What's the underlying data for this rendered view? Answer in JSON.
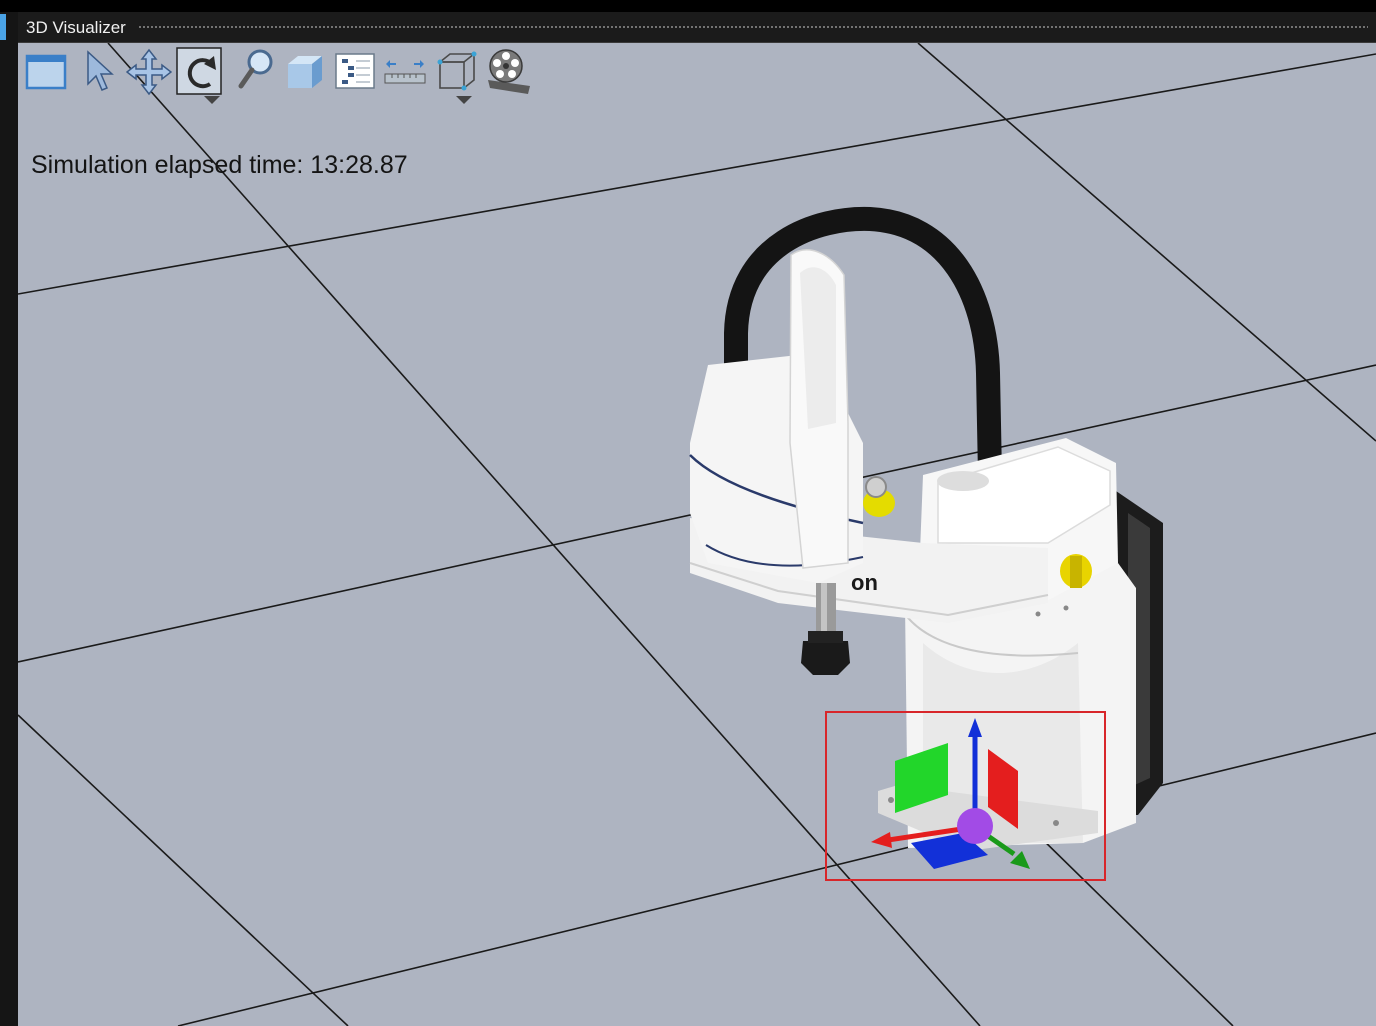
{
  "window": {
    "title": "3D Visualizer"
  },
  "toolbar": {
    "tools": [
      {
        "name": "view-window",
        "icon": "window-icon"
      },
      {
        "name": "select",
        "icon": "arrow-cursor-icon"
      },
      {
        "name": "pan",
        "icon": "move-arrows-icon"
      },
      {
        "name": "rotate",
        "icon": "rotate-icon",
        "active": true,
        "has_dropdown": true
      },
      {
        "name": "zoom",
        "icon": "magnifier-icon"
      },
      {
        "name": "3d-box",
        "icon": "cube-icon"
      },
      {
        "name": "tree",
        "icon": "tree-list-icon"
      },
      {
        "name": "measure",
        "icon": "ruler-icon"
      },
      {
        "name": "bounding-box",
        "icon": "wireframe-box-icon",
        "has_dropdown": true
      },
      {
        "name": "record",
        "icon": "film-reel-icon"
      }
    ]
  },
  "simulation": {
    "elapsed_label": "Simulation elapsed time:",
    "elapsed_value": "13:28.87",
    "elapsed_text": "Simulation elapsed time: 13:28.87"
  },
  "robot": {
    "brand_fragment": "on",
    "gizmo_colors": {
      "x": "#e41e1e",
      "y": "#1a9a1a",
      "z": "#1230d8",
      "origin": "#a24be6"
    }
  },
  "colors": {
    "background": "#aeb4c1",
    "grid_line": "#1a1a1a",
    "selection": "#d8262a"
  }
}
